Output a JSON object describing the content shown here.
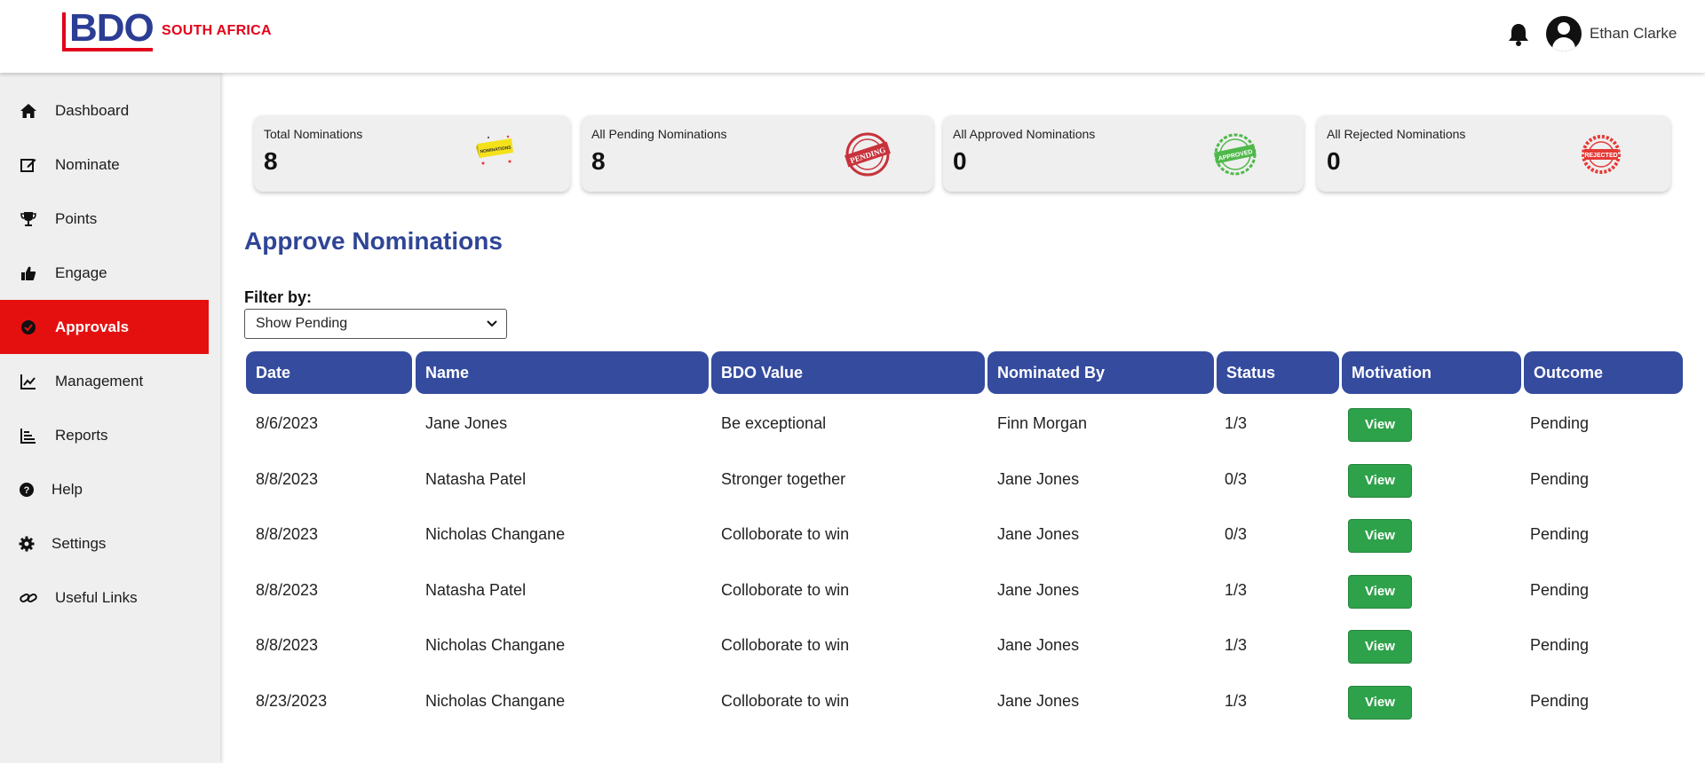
{
  "brand": {
    "logo_text": "BDO",
    "region": "SOUTH AFRICA",
    "primary": "#2b3d94",
    "accent": "#e2001a"
  },
  "header": {
    "bell_icon": "bell-icon",
    "avatar_icon": "user-avatar-icon",
    "user_name": "Ethan Clarke"
  },
  "sidebar": {
    "items": [
      {
        "label": "Dashboard",
        "icon": "home-icon"
      },
      {
        "label": "Nominate",
        "icon": "edit-icon"
      },
      {
        "label": "Points",
        "icon": "trophy-icon"
      },
      {
        "label": "Engage",
        "icon": "thumbs-up-icon"
      },
      {
        "label": "Approvals",
        "icon": "check-circle-icon",
        "active": true
      },
      {
        "label": "Management",
        "icon": "line-chart-icon"
      },
      {
        "label": "Reports",
        "icon": "bar-list-icon"
      },
      {
        "label": "Help",
        "icon": "question-circle-icon"
      },
      {
        "label": "Settings",
        "icon": "gear-icon"
      },
      {
        "label": "Useful Links",
        "icon": "link-icon"
      }
    ],
    "active_color": "#e41010"
  },
  "summary": {
    "cards": [
      {
        "label": "Total Nominations",
        "value": "8",
        "badge": "NOMINATIONS",
        "badge_icon": "nominations-ribbon-icon"
      },
      {
        "label": "All Pending Nominations",
        "value": "8",
        "badge": "PENDING",
        "badge_icon": "pending-stamp-icon"
      },
      {
        "label": "All Approved Nominations",
        "value": "0",
        "badge": "APPROVED",
        "badge_icon": "approved-stamp-icon"
      },
      {
        "label": "All Rejected Nominations",
        "value": "0",
        "badge": "REJECTED",
        "badge_icon": "rejected-stamp-icon"
      }
    ]
  },
  "main": {
    "title": "Approve Nominations",
    "filter": {
      "label": "Filter by:",
      "selected": "Show Pending"
    }
  },
  "table": {
    "header_color": "#354b9e",
    "columns": [
      "Date",
      "Name",
      "BDO Value",
      "Nominated By",
      "Status",
      "Motivation",
      "Outcome"
    ],
    "rows": [
      {
        "date": "8/6/2023",
        "name": "Jane Jones",
        "value": "Be exceptional",
        "nominated_by": "Finn Morgan",
        "status": "1/3",
        "motivation": "View",
        "outcome": "Pending"
      },
      {
        "date": "8/8/2023",
        "name": "Natasha Patel",
        "value": "Stronger together",
        "nominated_by": "Jane Jones",
        "status": "0/3",
        "motivation": "View",
        "outcome": "Pending"
      },
      {
        "date": "8/8/2023",
        "name": "Nicholas Changane",
        "value": "Colloborate to win",
        "nominated_by": "Jane Jones",
        "status": "0/3",
        "motivation": "View",
        "outcome": "Pending"
      },
      {
        "date": "8/8/2023",
        "name": "Natasha Patel",
        "value": "Colloborate to win",
        "nominated_by": "Jane Jones",
        "status": "1/3",
        "motivation": "View",
        "outcome": "Pending"
      },
      {
        "date": "8/8/2023",
        "name": "Nicholas Changane",
        "value": "Colloborate to win",
        "nominated_by": "Jane Jones",
        "status": "1/3",
        "motivation": "View",
        "outcome": "Pending"
      },
      {
        "date": "8/23/2023",
        "name": "Nicholas Changane",
        "value": "Colloborate to win",
        "nominated_by": "Jane Jones",
        "status": "1/3",
        "motivation": "View",
        "outcome": "Pending"
      }
    ]
  }
}
